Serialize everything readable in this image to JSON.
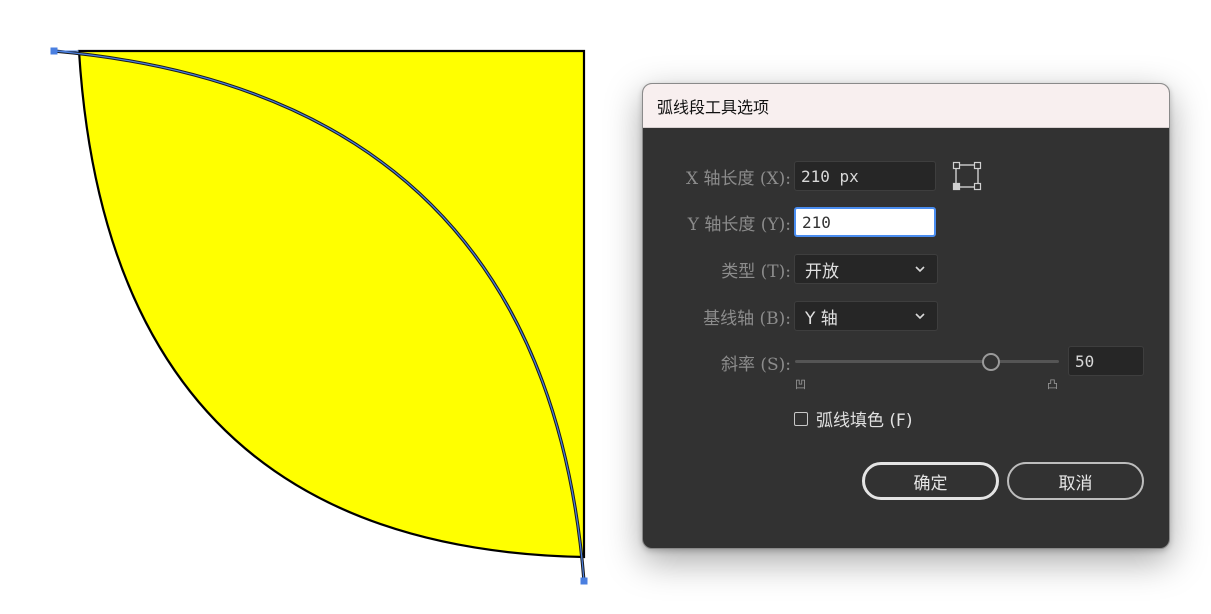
{
  "dialog": {
    "title": "弧线段工具选项",
    "fields": {
      "x_axis_length": {
        "label": "X 轴长度 (X):",
        "value": "210 px"
      },
      "y_axis_length": {
        "label": "Y 轴长度 (Y):",
        "value": "210"
      }
    },
    "type": {
      "label": "类型 (T):",
      "selected": "开放"
    },
    "base_axis": {
      "label": "基线轴 (B):",
      "selected": "Y 轴"
    },
    "slope": {
      "label": "斜率 (S):",
      "value": "50",
      "level": 0.74,
      "min_label": "凹",
      "max_label": "凸"
    },
    "fill_arc": {
      "label": "弧线填色 (F)",
      "checked": false
    },
    "ok_label": "确定",
    "cancel_label": "取消"
  },
  "colors": {
    "shape_fill": "#ffff00",
    "anchor": "#4a7fe0",
    "dialog_bg": "#323232",
    "title_bg": "#f8efef",
    "focus_border": "#4a8df0"
  },
  "icons": {
    "reference_point": "reference-point-icon",
    "chevron": "chevron-down-icon"
  }
}
